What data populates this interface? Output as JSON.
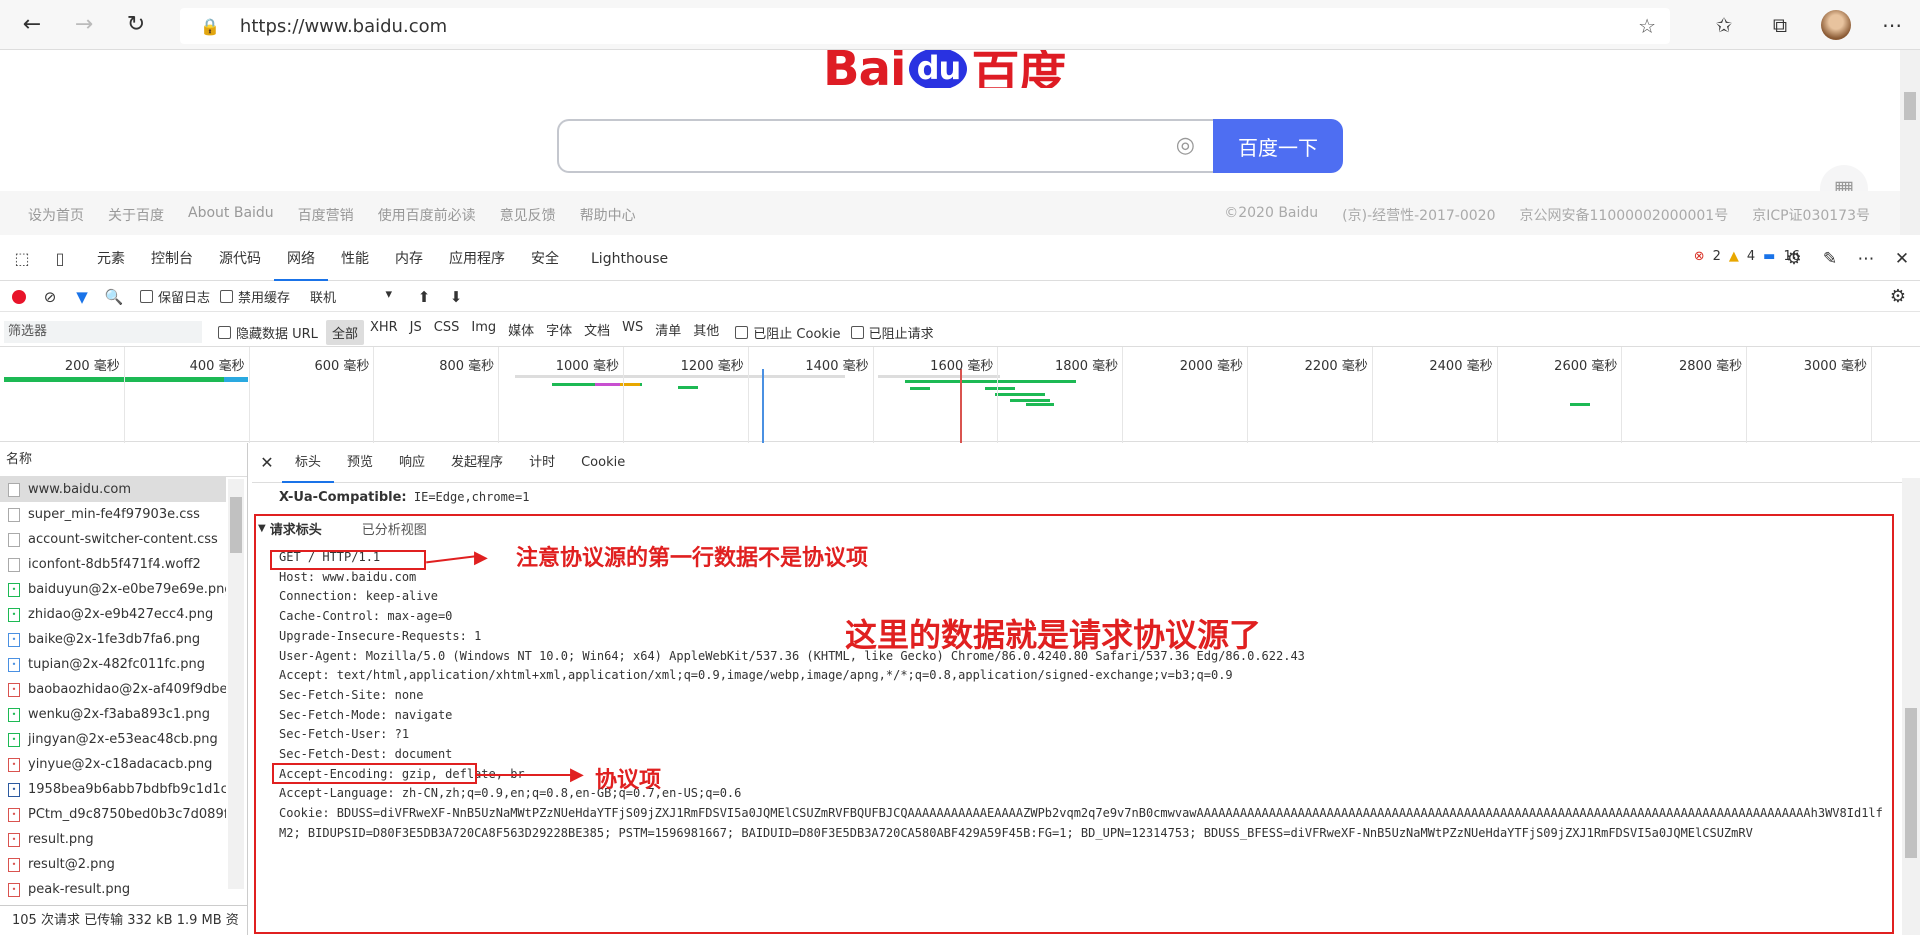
{
  "browser": {
    "url": "https://www.baidu.com",
    "back": "←",
    "forward": "→",
    "reload": "↻",
    "star": "☆",
    "favorites": "☆̲",
    "collections": "⧉",
    "more": "⋯"
  },
  "page": {
    "logo_left": "Bai",
    "logo_mid": "du",
    "logo_right": "百度",
    "search_button": "百度一下",
    "footer_left": [
      "设为首页",
      "关于百度",
      "About Baidu",
      "百度营销",
      "使用百度前必读",
      "意见反馈",
      "帮助中心"
    ],
    "footer_right": [
      "©2020 Baidu",
      "(京)-经营性-2017-0020",
      "京公网安备11000002000001号",
      "京ICP证030173号"
    ]
  },
  "devtools": {
    "tabs": [
      "元素",
      "控制台",
      "源代码",
      "网络",
      "性能",
      "内存",
      "应用程序",
      "安全",
      "Lighthouse"
    ],
    "active_tab": "网络",
    "errors": "2",
    "warnings": "4",
    "messages": "16",
    "toolbar": {
      "preserve_log": "保留日志",
      "disable_cache": "禁用缓存",
      "throttle": "联机"
    },
    "filter": {
      "placeholder": "筛选器",
      "hide_data_url": "隐藏数据 URL",
      "types": [
        "全部",
        "XHR",
        "JS",
        "CSS",
        "Img",
        "媒体",
        "字体",
        "文档",
        "WS",
        "清单",
        "其他"
      ],
      "blocked_cookies": "已阻止 Cookie",
      "blocked_requests": "已阻止请求"
    },
    "timeline_ticks": [
      "200 毫秒",
      "400 毫秒",
      "600 毫秒",
      "800 毫秒",
      "1000 毫秒",
      "1200 毫秒",
      "1400 毫秒",
      "1600 毫秒",
      "1800 毫秒",
      "2000 毫秒",
      "2200 毫秒",
      "2400 毫秒",
      "2600 毫秒",
      "2800 毫秒",
      "3000 毫秒"
    ],
    "requests_header": "名称",
    "requests": [
      "www.baidu.com",
      "super_min-fe4f97903e.css",
      "account-switcher-content.css",
      "iconfont-8db5f471f4.woff2",
      "baiduyun@2x-e0be79e69e.png",
      "zhidao@2x-e9b427ecc4.png",
      "baike@2x-1fe3db7fa6.png",
      "tupian@2x-482fc011fc.png",
      "baobaozhidao@2x-af409f9dbe",
      "wenku@2x-f3aba893c1.png",
      "jingyan@2x-e53eac48cb.png",
      "yinyue@2x-c18adacacb.png",
      "1958bea9b6abb7bdbfb9c1d1c9",
      "PCtm_d9c8750bed0b3c7d089fa",
      "result.png",
      "result@2.png",
      "peak-result.png"
    ],
    "status_bar": "105 次请求  已传输 332 kB  1.9 MB 资",
    "detail_tabs": [
      "标头",
      "预览",
      "响应",
      "发起程序",
      "计时",
      "Cookie"
    ],
    "active_detail_tab": "标头",
    "compat_name": "X-Ua-Compatible:",
    "compat_value": "IE=Edge,chrome=1",
    "section_title": "请求标头",
    "section_alt": "已分析视图",
    "header_lines": [
      "GET / HTTP/1.1",
      "Host: www.baidu.com",
      "Connection: keep-alive",
      "Cache-Control: max-age=0",
      "Upgrade-Insecure-Requests: 1",
      "User-Agent: Mozilla/5.0 (Windows NT 10.0; Win64; x64) AppleWebKit/537.36 (KHTML, like Gecko) Chrome/86.0.4240.80 Safari/537.36 Edg/86.0.622.43",
      "Accept: text/html,application/xhtml+xml,application/xml;q=0.9,image/webp,image/apng,*/*;q=0.8,application/signed-exchange;v=b3;q=0.9",
      "Sec-Fetch-Site: none",
      "Sec-Fetch-Mode: navigate",
      "Sec-Fetch-User: ?1",
      "Sec-Fetch-Dest: document",
      "Accept-Encoding: gzip, deflate, br",
      "Accept-Language: zh-CN,zh;q=0.9,en;q=0.8,en-GB;q=0.7,en-US;q=0.6",
      "Cookie: BDUSS=diVFRweXF-NnB5UzNaMWtPZzNUeHdaYTFjS09jZXJ1RmFDSVI5a0JQMElCSUZmRVFBQUFBJCQAAAAAAAAAAAEAAAAZWPb2vqm2q7e9v7nB0cmwvawAAAAAAAAAAAAAAAAAAAAAAAAAAAAAAAAAAAAAAAAAAAAAAAAAAAAAAAAAAAAAAAAAAAAAAAAAAAAAAAAAAAAAh3WV8Id1lf",
      "M2; BIDUPSID=D80F3E5DB3A720CA8F563D29228BE385; PSTM=1596981667; BAIDUID=D80F3E5DB3A720CA580ABF429A59F45B:FG=1; BD_UPN=12314753; BDUSS_BFESS=diVFRweXF-NnB5UzNaMWtPZzNUeHdaYTFjS09jZXJ1RmFDSVI5a0JQMElCSUZmRV"
    ],
    "annotations": {
      "first_line": "注意协议源的第一行数据不是协议项",
      "main": "这里的数据就是请求协议源了",
      "item": "协议项"
    }
  }
}
